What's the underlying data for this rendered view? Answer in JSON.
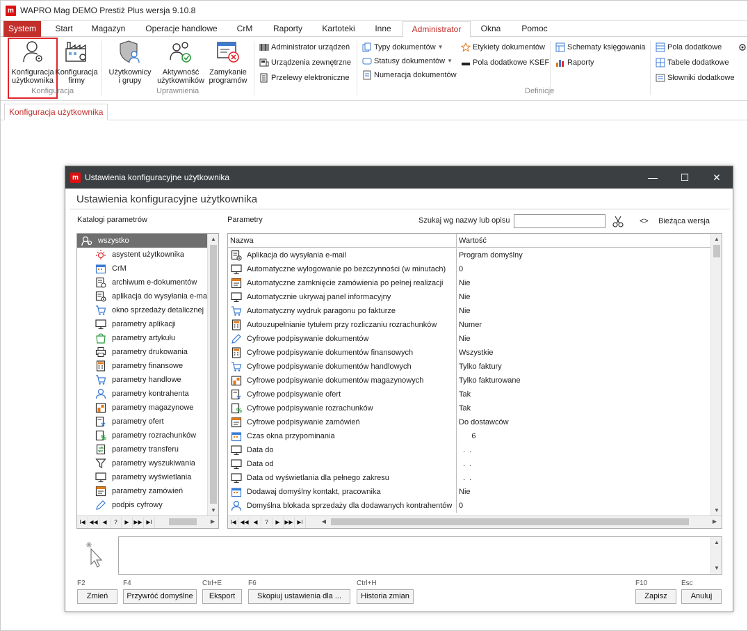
{
  "app": {
    "logo_letter": "m",
    "title": "WAPRO Mag DEMO Prestiż Plus  wersja 9.10.8"
  },
  "menu": [
    "System",
    "Start",
    "Magazyn",
    "Operacje handlowe",
    "CrM",
    "Raporty",
    "Kartoteki",
    "Inne",
    "Administrator",
    "Okna",
    "Pomoc"
  ],
  "ribbon": {
    "konfiguracja_uzytkownika": "Konfiguracja\nużytkownika",
    "konfiguracja_firmy": "Konfiguracja\nfirmy",
    "group_konfiguracja": "Konfiguracja",
    "uzytkownicy": "Użytkownicy\ni grupy",
    "aktywnosc": "Aktywność\nużytkowników",
    "zamykanie": "Zamykanie\nprogramów",
    "group_uprawnienia": "Uprawnienia",
    "administrator_urzadzen": "Administrator urządzeń",
    "urzadzenia_zewnetrzne": "Urządzenia zewnętrzne",
    "przelewy": "Przelewy elektroniczne",
    "typy_dokumentow": "Typy dokumentów",
    "statusy_dokumentow": "Statusy dokumentów",
    "numeracja": "Numeracja dokumentów",
    "etykiety": "Etykiety dokumentów",
    "pola_ksef": "Pola dodatkowe KSEF",
    "schematy": "Schematy księgowania",
    "raporty": "Raporty",
    "pola_dodatkowe": "Pola dodatkowe",
    "tabele_dodatkowe": "Tabele dodatkowe",
    "slowniki": "Słowniki dodatkowe",
    "group_definicje": "Definicje"
  },
  "doctab": "Konfiguracja użytkownika",
  "dialog": {
    "title": "Ustawienia konfiguracyjne użytkownika",
    "heading": "Ustawienia konfiguracyjne użytkownika",
    "catalog_label": "Katalogi parametrów",
    "params_label": "Parametry",
    "search_label": "Szukaj wg nazwy lub opisu",
    "search_value": "",
    "version_arrows": "<>",
    "version_label": "Bieżąca wersja",
    "col_name": "Nazwa",
    "col_value": "Wartość"
  },
  "catalog": [
    {
      "label": "wszystko",
      "icon": "search-users-icon",
      "selected": true
    },
    {
      "label": "asystent użytkownika",
      "icon": "sun-icon"
    },
    {
      "label": "CrM",
      "icon": "calendar-icon"
    },
    {
      "label": "archiwum e-dokumentów",
      "icon": "archive-icon"
    },
    {
      "label": "aplikacja do wysyłania e-ma",
      "icon": "settings-doc-icon"
    },
    {
      "label": "okno sprzedaży detalicznej",
      "icon": "cart-icon"
    },
    {
      "label": "parametry aplikacji",
      "icon": "monitor-icon"
    },
    {
      "label": "parametry artykułu",
      "icon": "bag-icon"
    },
    {
      "label": "parametry drukowania",
      "icon": "printer-icon"
    },
    {
      "label": "parametry finansowe",
      "icon": "calculator-icon"
    },
    {
      "label": "parametry handlowe",
      "icon": "cart-icon"
    },
    {
      "label": "parametry kontrahenta",
      "icon": "user-icon"
    },
    {
      "label": "parametry magazynowe",
      "icon": "warehouse-icon"
    },
    {
      "label": "parametry ofert",
      "icon": "offer-icon"
    },
    {
      "label": "parametry rozrachunków",
      "icon": "percent-icon"
    },
    {
      "label": "parametry transferu",
      "icon": "transfer-icon"
    },
    {
      "label": "parametry wyszukiwania",
      "icon": "filter-icon"
    },
    {
      "label": "parametry wyświetlania",
      "icon": "monitor-icon"
    },
    {
      "label": "parametry zamówień",
      "icon": "order-icon"
    },
    {
      "label": "podpis cyfrowy",
      "icon": "pen-icon"
    }
  ],
  "params": [
    {
      "name": "Aplikacja do wysyłania e-mail",
      "value": "Program domyślny",
      "icon": "settings-doc-icon"
    },
    {
      "name": "Automatyczne wylogowanie po bezczynności (w minutach)",
      "value": "0",
      "icon": "monitor-icon"
    },
    {
      "name": "Automatyczne zamknięcie zamówienia po pełnej realizacji",
      "value": "Nie",
      "icon": "order-icon"
    },
    {
      "name": "Automatycznie ukrywaj panel informacyjny",
      "value": "Nie",
      "icon": "monitor-icon"
    },
    {
      "name": "Automatyczny wydruk paragonu po fakturze",
      "value": "Nie",
      "icon": "cart-icon"
    },
    {
      "name": "Autouzupełnianie tytułem przy rozliczaniu rozrachunków",
      "value": "Numer",
      "icon": "calculator-icon"
    },
    {
      "name": "Cyfrowe podpisywanie dokumentów",
      "value": "Nie",
      "icon": "pen-icon"
    },
    {
      "name": "Cyfrowe podpisywanie dokumentów finansowych",
      "value": "Wszystkie",
      "icon": "calculator-icon"
    },
    {
      "name": "Cyfrowe podpisywanie dokumentów handlowych",
      "value": "Tylko faktury",
      "icon": "cart-icon"
    },
    {
      "name": "Cyfrowe podpisywanie dokumentów magazynowych",
      "value": "Tylko fakturowane",
      "icon": "warehouse-icon"
    },
    {
      "name": "Cyfrowe podpisywanie ofert",
      "value": "Tak",
      "icon": "offer-icon"
    },
    {
      "name": "Cyfrowe podpisywanie rozrachunków",
      "value": "Tak",
      "icon": "percent-icon"
    },
    {
      "name": "Cyfrowe podpisywanie zamówień",
      "value": "Do dostawców",
      "icon": "order-icon"
    },
    {
      "name": "Czas okna przypominania",
      "value": "      6",
      "icon": "calendar-icon"
    },
    {
      "name": "Data do",
      "value": "  .  .",
      "icon": "monitor-icon"
    },
    {
      "name": "Data od",
      "value": "  .  .",
      "icon": "monitor-icon"
    },
    {
      "name": "Data od wyświetlania dla pełnego zakresu",
      "value": "  .  .",
      "icon": "monitor-icon"
    },
    {
      "name": "Dodawaj domyślny kontakt, pracownika",
      "value": "Nie",
      "icon": "calendar-icon"
    },
    {
      "name": "Domyślna blokada sprzedaży dla dodawanych kontrahentów",
      "value": "0",
      "icon": "user-icon"
    }
  ],
  "nav_buttons": [
    "I◀",
    "◀◀",
    "◀",
    "?",
    "▶",
    "▶▶",
    "▶I"
  ],
  "footer": {
    "f2": "F2",
    "zmien": "Zmień",
    "f4": "F4",
    "przywroc": "Przywróć domyślne",
    "ctrle": "Ctrl+E",
    "eksport": "Eksport",
    "f6": "F6",
    "kopiuj": "Skopiuj ustawienia dla ...",
    "ctrlh": "Ctrl+H",
    "historia": "Historia zmian",
    "f10": "F10",
    "zapisz": "Zapisz",
    "esc": "Esc",
    "anuluj": "Anuluj"
  },
  "colors": {
    "accent": "#c3302c",
    "highlight": "#e0262b",
    "dialog_title": "#3c3f41",
    "selected_row": "#6f6f6f"
  }
}
